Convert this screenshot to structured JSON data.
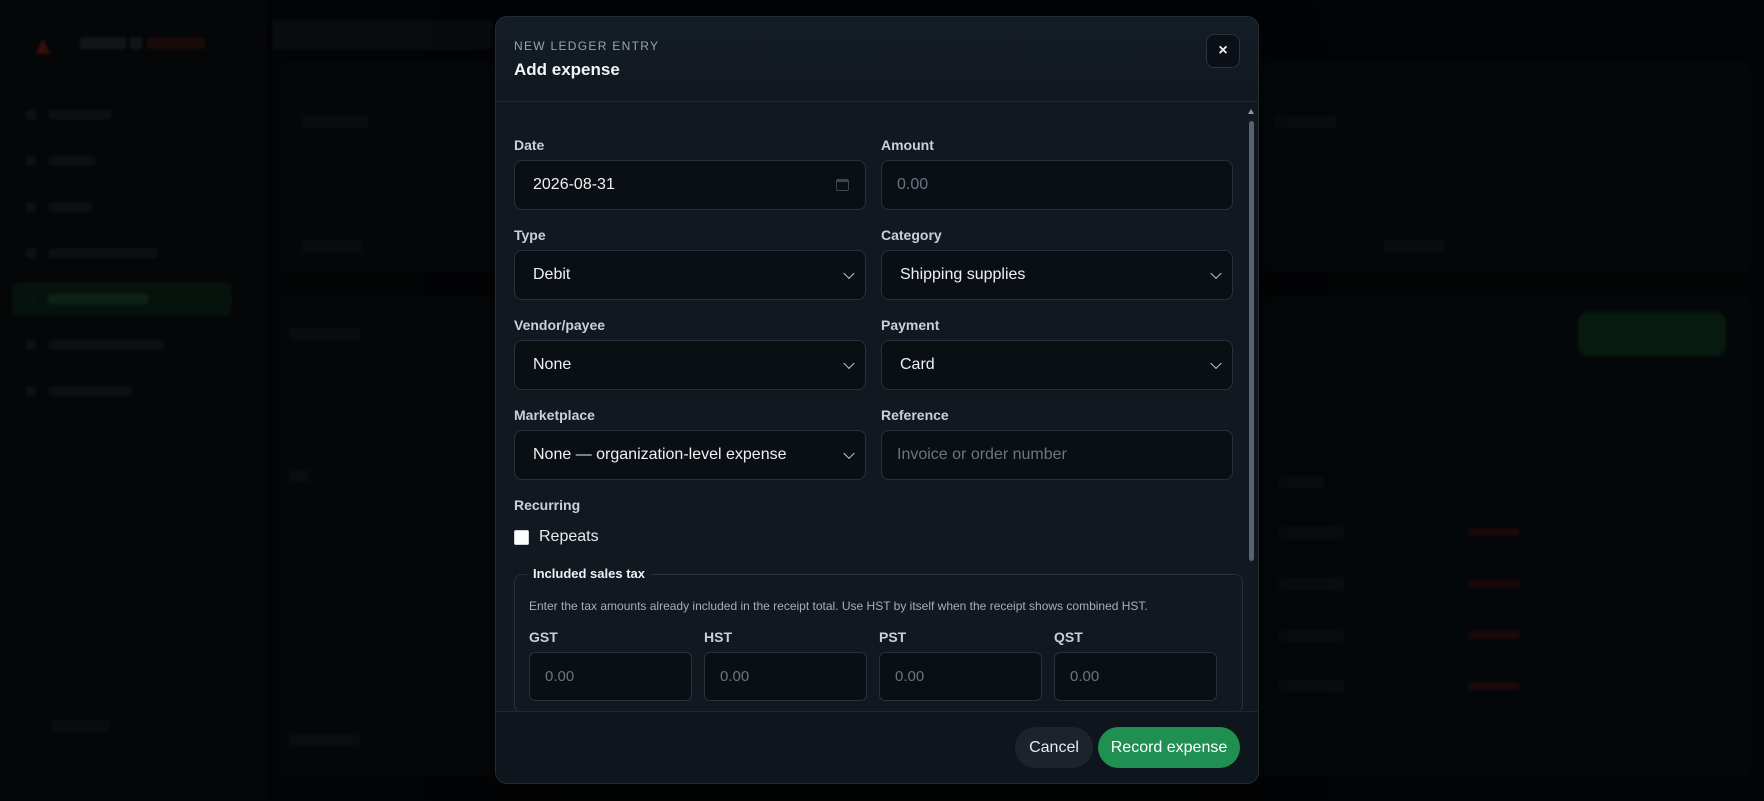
{
  "modal": {
    "eyebrow": "NEW LEDGER ENTRY",
    "title": "Add expense",
    "close_glyph": "×"
  },
  "form": {
    "date": {
      "label": "Date",
      "value": "2026-08-31"
    },
    "amount": {
      "label": "Amount",
      "placeholder": "0.00"
    },
    "type": {
      "label": "Type",
      "value": "Debit"
    },
    "category": {
      "label": "Category",
      "value": "Shipping supplies"
    },
    "vendor": {
      "label": "Vendor/payee",
      "value": "None"
    },
    "payment": {
      "label": "Payment",
      "value": "Card"
    },
    "marketplace": {
      "label": "Marketplace",
      "value": "None — organization-level expense"
    },
    "reference": {
      "label": "Reference",
      "placeholder": "Invoice or order number"
    },
    "recurring": {
      "label": "Recurring",
      "checkbox_label": "Repeats",
      "checked": false
    }
  },
  "tax": {
    "legend": "Included sales tax",
    "note": "Enter the tax amounts already included in the receipt total. Use HST by itself when the receipt shows combined HST.",
    "fields": [
      {
        "label": "GST",
        "placeholder": "0.00"
      },
      {
        "label": "HST",
        "placeholder": "0.00"
      },
      {
        "label": "PST",
        "placeholder": "0.00"
      },
      {
        "label": "QST",
        "placeholder": "0.00"
      }
    ]
  },
  "footer": {
    "cancel_label": "Cancel",
    "submit_label": "Record expense"
  },
  "colors": {
    "primary": "#1f8f52",
    "modal_bg": "#111820",
    "input_bg": "#0a0f14"
  }
}
